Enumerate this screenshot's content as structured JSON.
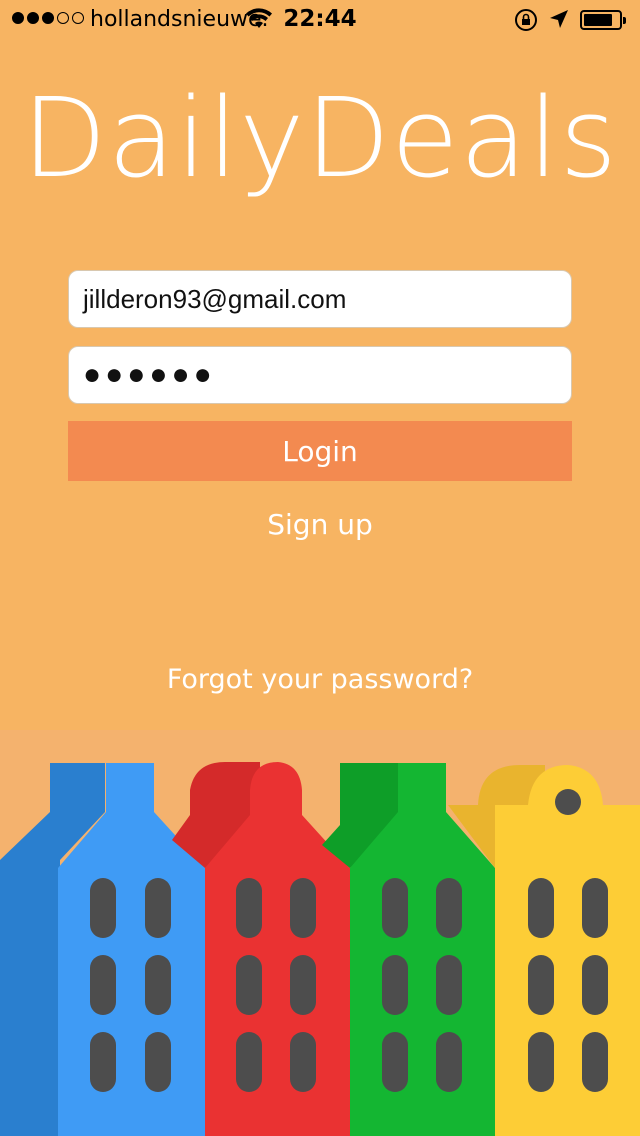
{
  "status_bar": {
    "carrier": "hollandsnieuwe.",
    "time": "22:44",
    "icons": [
      "signal-dots-icon",
      "wifi-icon",
      "rotation-lock-icon",
      "location-arrow-icon",
      "battery-icon"
    ]
  },
  "app": {
    "title": "DailyDeals"
  },
  "login_form": {
    "email_value": "jillderon93@gmail.com",
    "password_value": "●●●●●●",
    "login_label": "Login",
    "signup_label": "Sign up",
    "forgot_label": "Forgot your password?"
  },
  "colors": {
    "background": "#F7B462",
    "login_button": "#F38A50",
    "building_blue": "#3F9BF5",
    "building_red": "#EA3232",
    "building_green": "#14B632",
    "building_yellow": "#FDCD36",
    "window": "#4D4D4D"
  }
}
